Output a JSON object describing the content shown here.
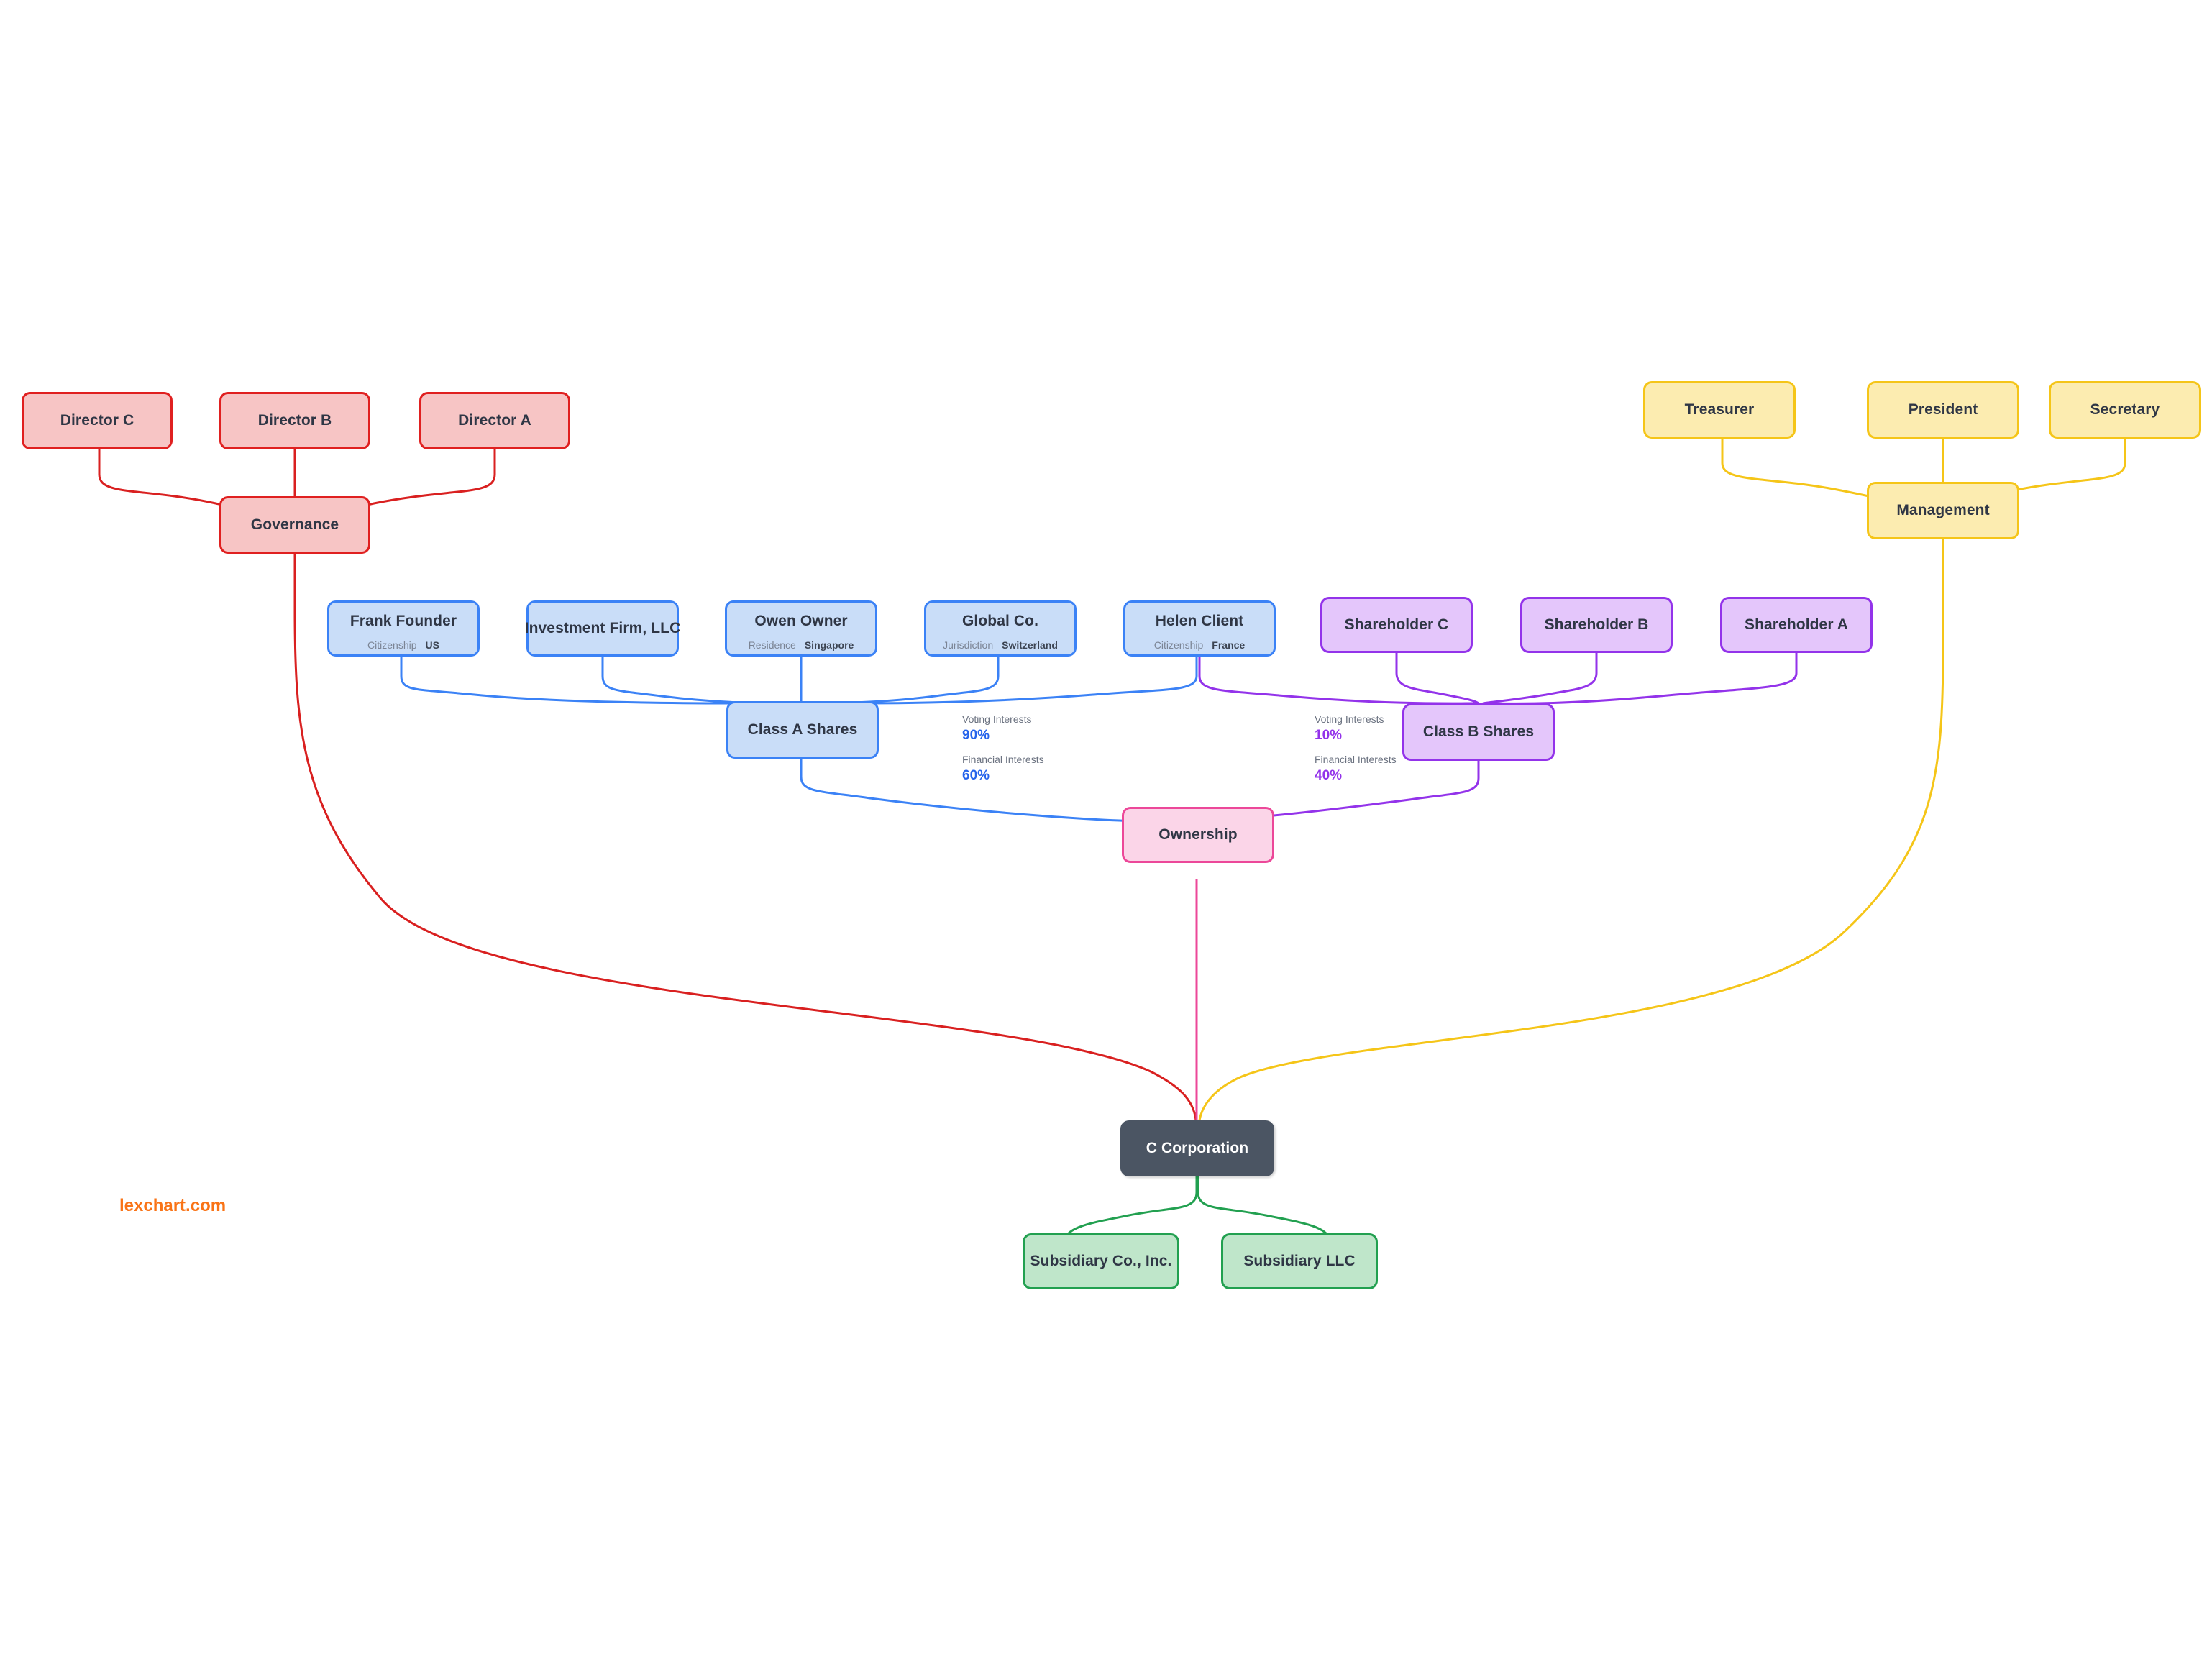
{
  "diagram": {
    "title": "C Corporation ownership, governance and management chart",
    "watermark": "lexchart.com",
    "colors": {
      "governance_red": "#e02020",
      "share_blue": "#3b82f6",
      "share_purple": "#9333ea",
      "management_yellow": "#f5c518",
      "ownership_pink": "#ec4899",
      "subsidiary_green": "#22a050",
      "entity_dark": "#4b5563",
      "watermark_orange": "#f97316"
    }
  },
  "nodes": {
    "director_c": {
      "label": "Director C"
    },
    "director_b": {
      "label": "Director B"
    },
    "director_a": {
      "label": "Director A"
    },
    "governance": {
      "label": "Governance"
    },
    "frank_founder": {
      "label": "Frank Founder",
      "attr_label": "Citizenship",
      "attr_value": "US"
    },
    "investment_firm": {
      "label": "Investment Firm, LLC"
    },
    "owen_owner": {
      "label": "Owen Owner",
      "attr_label": "Residence",
      "attr_value": "Singapore"
    },
    "global_co": {
      "label": "Global Co.",
      "attr_label": "Jurisdiction",
      "attr_value": "Switzerland"
    },
    "helen_client": {
      "label": "Helen Client",
      "attr_label": "Citizenship",
      "attr_value": "France"
    },
    "shareholder_c": {
      "label": "Shareholder C"
    },
    "shareholder_b": {
      "label": "Shareholder B"
    },
    "shareholder_a": {
      "label": "Shareholder A"
    },
    "class_a_shares": {
      "label": "Class A Shares"
    },
    "class_b_shares": {
      "label": "Class B Shares"
    },
    "ownership": {
      "label": "Ownership"
    },
    "treasurer": {
      "label": "Treasurer"
    },
    "president": {
      "label": "President"
    },
    "secretary": {
      "label": "Secretary"
    },
    "management": {
      "label": "Management"
    },
    "c_corporation": {
      "label": "C Corporation"
    },
    "subsidiary_co": {
      "label": "Subsidiary Co., Inc."
    },
    "subsidiary_llc": {
      "label": "Subsidiary LLC"
    }
  },
  "interests": {
    "class_a": {
      "voting_label": "Voting Interests",
      "voting_value": "90%",
      "financial_label": "Financial Interests",
      "financial_value": "60%"
    },
    "class_b": {
      "voting_label": "Voting Interests",
      "voting_value": "10%",
      "financial_label": "Financial Interests",
      "financial_value": "40%"
    }
  }
}
